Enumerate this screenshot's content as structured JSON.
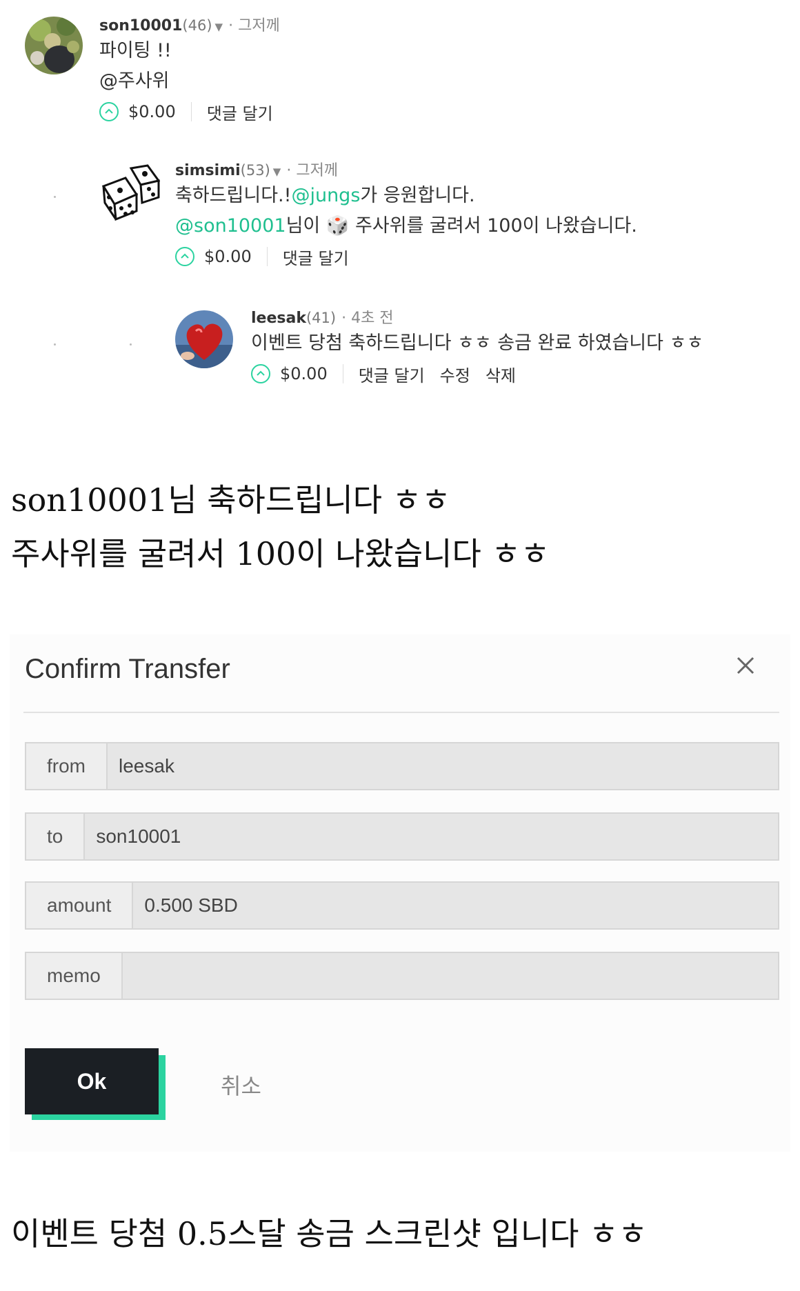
{
  "comments": [
    {
      "author": "son10001",
      "rep": "(46)",
      "time": "그저께",
      "lines": [
        "파이팅 !!",
        "@주사위"
      ],
      "payout": "$0.00",
      "actions": [
        "댓글 달기"
      ]
    },
    {
      "author": "simsimi",
      "rep": "(53)",
      "time": "그저께",
      "line1_pre": "축하드립니다.!",
      "line1_mention": "@jungs",
      "line1_post": "가 응원합니다.",
      "line2_mention": "@son10001",
      "line2_post": "님이 🎲 주사위를 굴려서 100이 나왔습니다.",
      "payout": "$0.00",
      "actions": [
        "댓글 달기"
      ]
    },
    {
      "author": "leesak",
      "rep": "(41)",
      "time": "4초 전",
      "text": "이벤트 당첨 축하드립니다 ㅎㅎ 송금 완료 하였습니다 ㅎㅎ",
      "payout": "$0.00",
      "actions": [
        "댓글 달기",
        "수정",
        "삭제"
      ]
    }
  ],
  "captions": {
    "line1": "son10001님 축하드립니다 ㅎㅎ",
    "line2": "주사위를 굴려서 100이 나왔습니다 ㅎㅎ",
    "line3": "이벤트 당첨 0.5스달 송금 스크린샷 입니다 ㅎㅎ"
  },
  "dialog": {
    "title": "Confirm Transfer",
    "fields": {
      "from": {
        "label": "from",
        "value": "leesak"
      },
      "to": {
        "label": "to",
        "value": "son10001"
      },
      "amount": {
        "label": "amount",
        "value": "0.500 SBD"
      },
      "memo": {
        "label": "memo",
        "value": ""
      }
    },
    "ok_label": "Ok",
    "cancel_label": "취소"
  },
  "colors": {
    "mention": "#1fbf8f",
    "accent": "#2bd3a0",
    "ok_button": "#1b1f24"
  }
}
